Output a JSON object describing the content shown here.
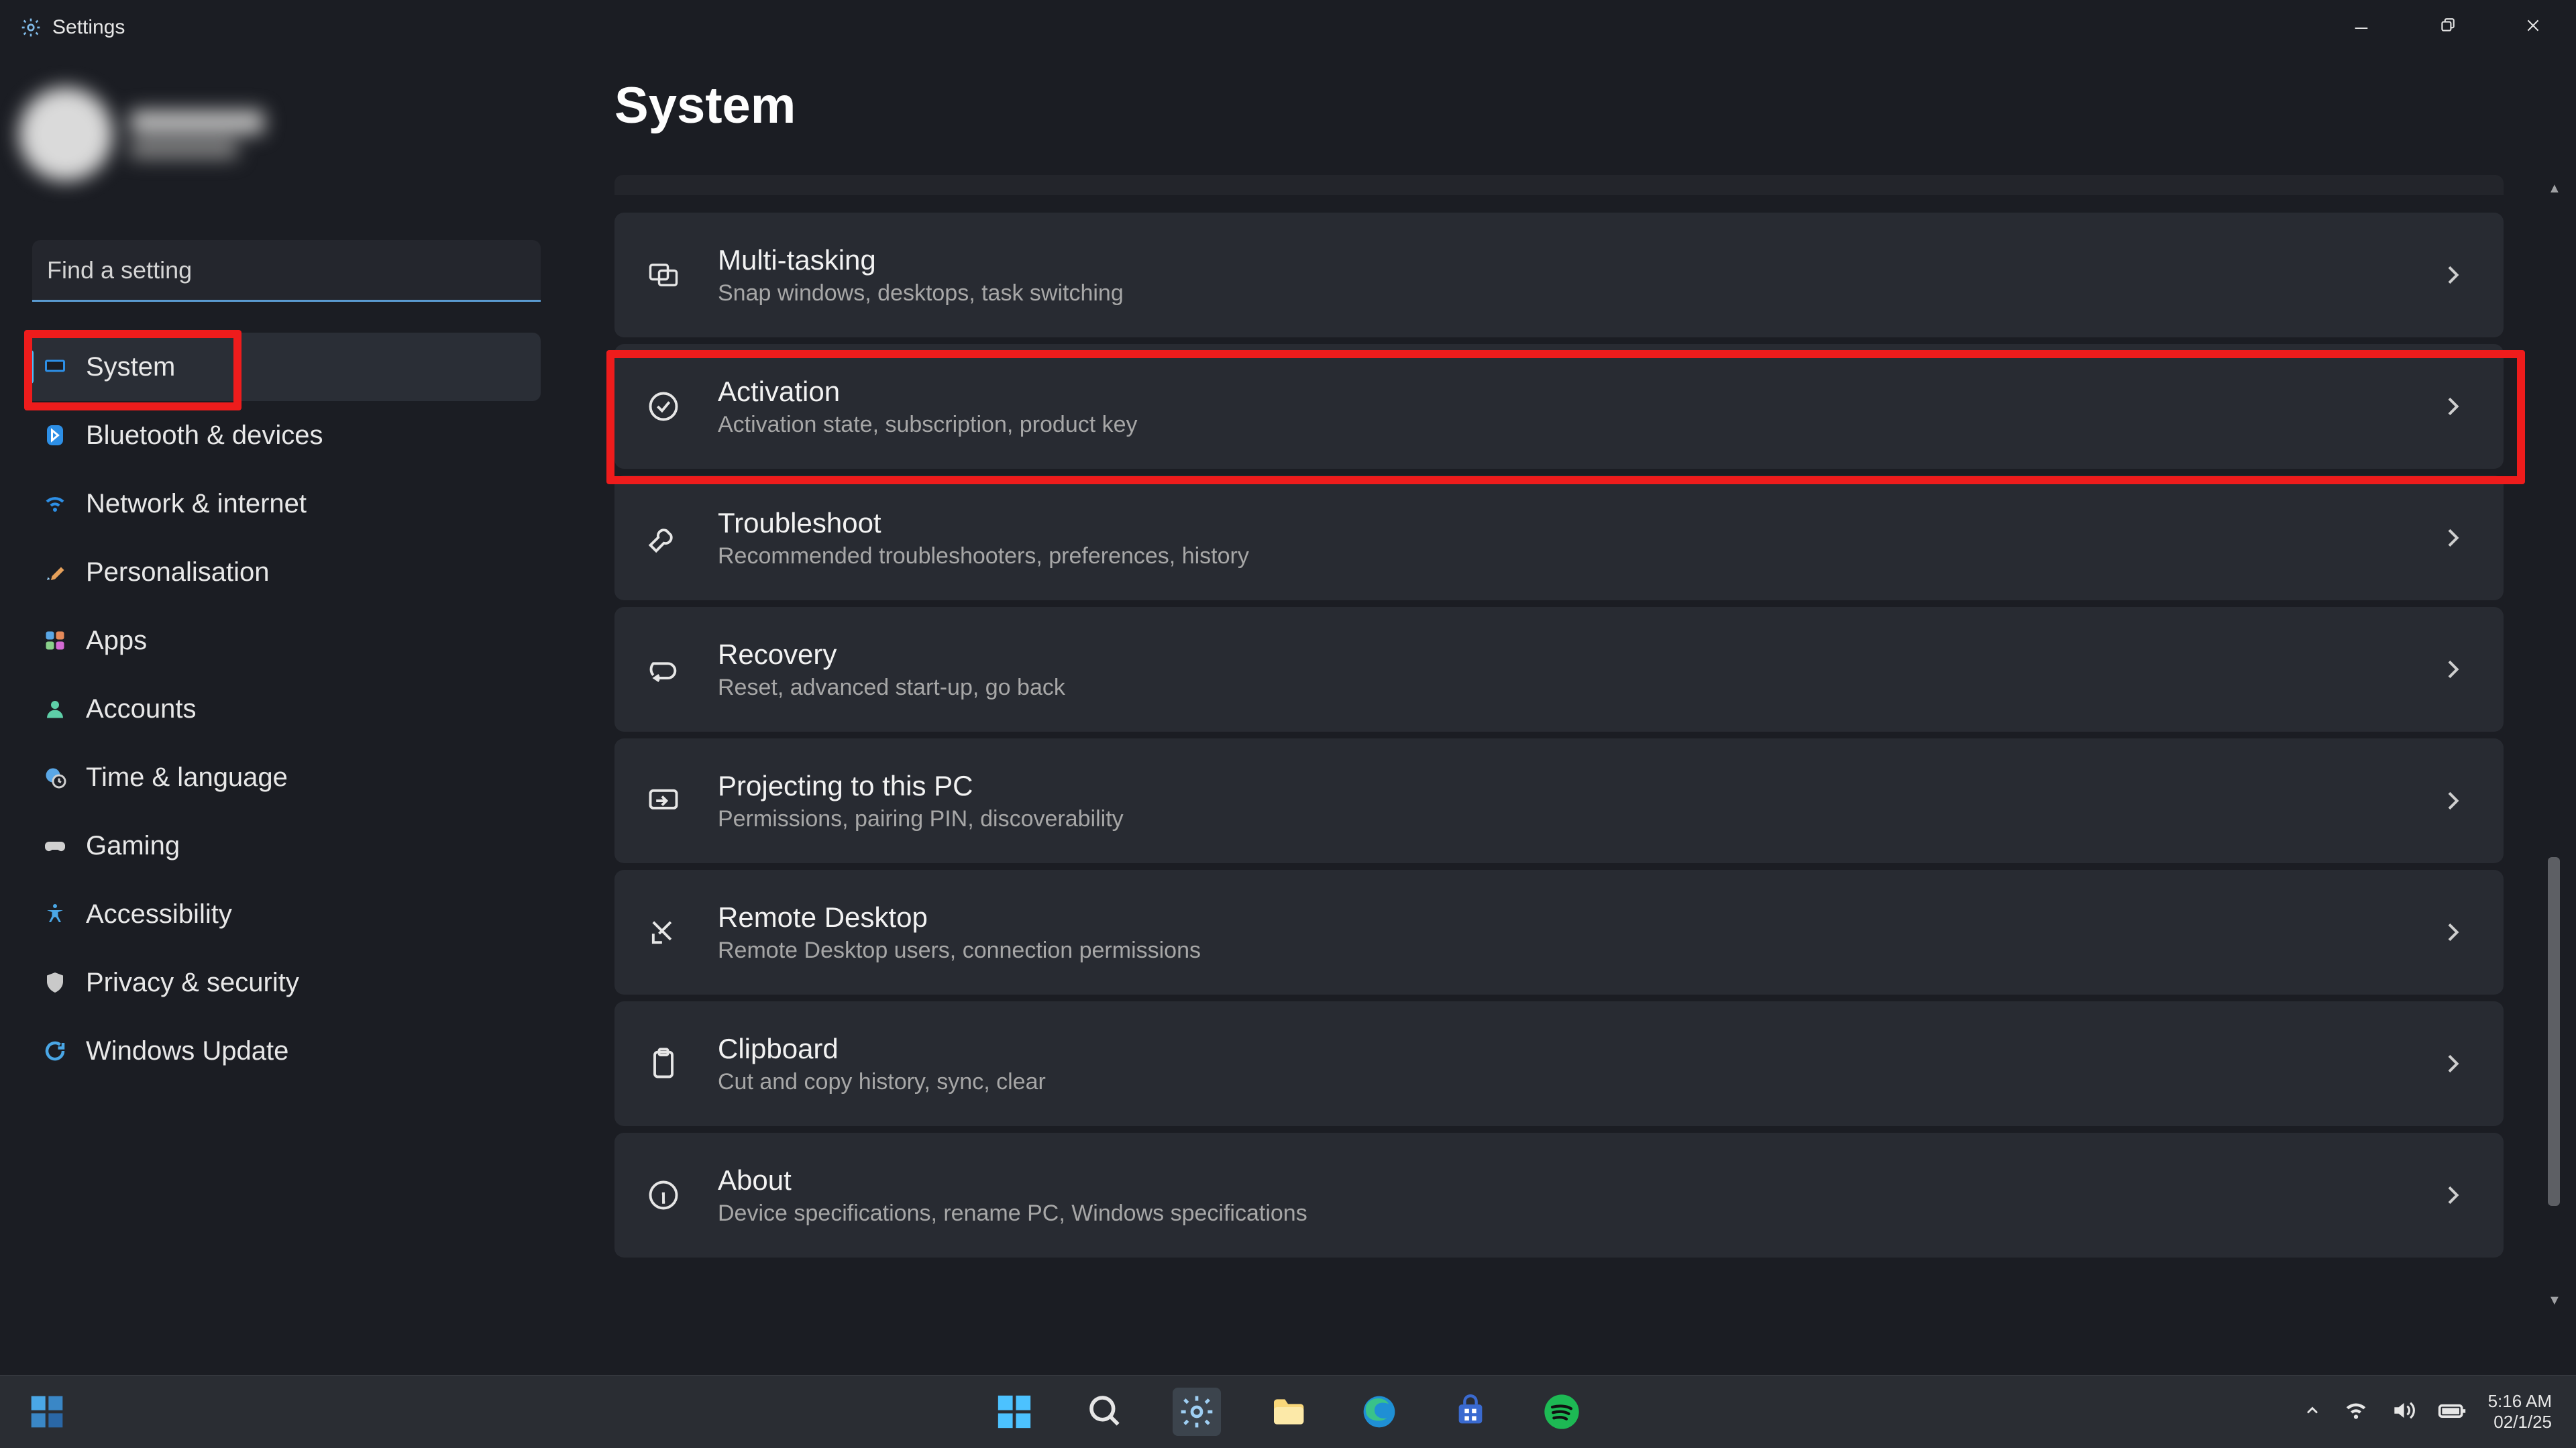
{
  "app": {
    "title": "Settings"
  },
  "search": {
    "placeholder": "Find a setting"
  },
  "sidebar": {
    "selected_index": 0,
    "items": [
      {
        "label": "System",
        "icon": "monitor-icon"
      },
      {
        "label": "Bluetooth & devices",
        "icon": "bluetooth-icon"
      },
      {
        "label": "Network & internet",
        "icon": "wifi-icon"
      },
      {
        "label": "Personalisation",
        "icon": "paintbrush-icon"
      },
      {
        "label": "Apps",
        "icon": "apps-icon"
      },
      {
        "label": "Accounts",
        "icon": "person-icon"
      },
      {
        "label": "Time & language",
        "icon": "globe-clock-icon"
      },
      {
        "label": "Gaming",
        "icon": "gamepad-icon"
      },
      {
        "label": "Accessibility",
        "icon": "accessibility-icon"
      },
      {
        "label": "Privacy & security",
        "icon": "shield-icon"
      },
      {
        "label": "Windows Update",
        "icon": "update-icon"
      }
    ]
  },
  "main": {
    "title": "System",
    "rows": [
      {
        "title": "Multi-tasking",
        "sub": "Snap windows, desktops, task switching",
        "icon": "windows-duo-icon"
      },
      {
        "title": "Activation",
        "sub": "Activation state, subscription, product key",
        "icon": "check-circle-icon"
      },
      {
        "title": "Troubleshoot",
        "sub": "Recommended troubleshooters, preferences, history",
        "icon": "wrench-icon"
      },
      {
        "title": "Recovery",
        "sub": "Reset, advanced start-up, go back",
        "icon": "recovery-icon"
      },
      {
        "title": "Projecting to this PC",
        "sub": "Permissions, pairing PIN, discoverability",
        "icon": "project-icon"
      },
      {
        "title": "Remote Desktop",
        "sub": "Remote Desktop users, connection permissions",
        "icon": "remote-desktop-icon"
      },
      {
        "title": "Clipboard",
        "sub": "Cut and copy history, sync, clear",
        "icon": "clipboard-icon"
      },
      {
        "title": "About",
        "sub": "Device specifications, rename PC, Windows specifications",
        "icon": "info-icon"
      }
    ],
    "highlighted_row_index": 1
  },
  "taskbar": {
    "items": [
      {
        "name": "windows-start-icon"
      },
      {
        "name": "search-icon"
      },
      {
        "name": "settings-icon",
        "active": true
      },
      {
        "name": "file-explorer-icon"
      },
      {
        "name": "edge-browser-icon"
      },
      {
        "name": "microsoft-store-icon"
      },
      {
        "name": "spotify-icon"
      }
    ],
    "tray": [
      {
        "name": "tray-expand-icon"
      },
      {
        "name": "wifi-tray-icon"
      },
      {
        "name": "volume-tray-icon"
      },
      {
        "name": "battery-tray-icon"
      }
    ],
    "clock": {
      "time": "5:16 AM",
      "date": "02/1/25"
    }
  },
  "annotations": {
    "highlight_sidebar_item_index": 0,
    "highlight_main_row_index": 1
  }
}
